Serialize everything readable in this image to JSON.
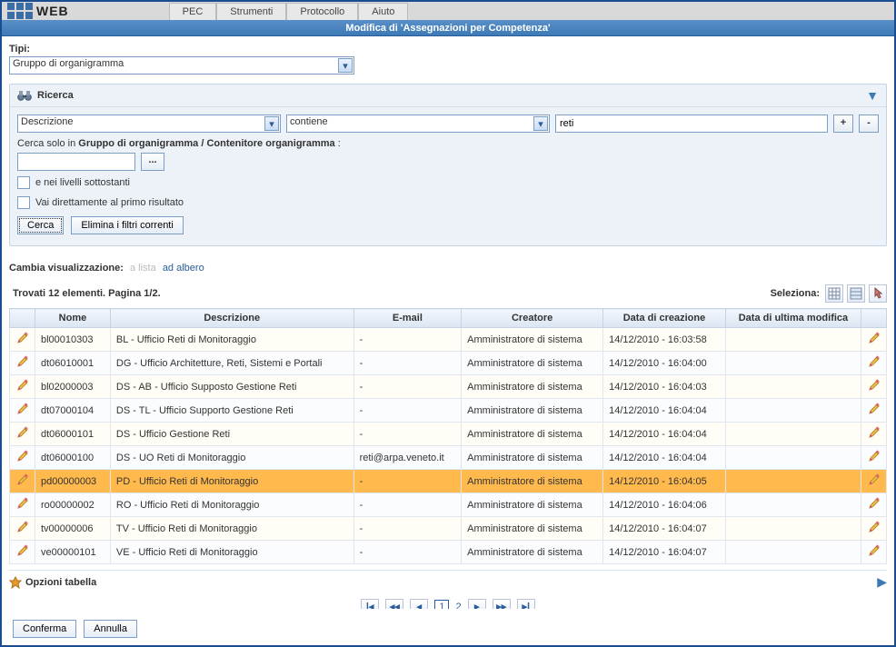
{
  "logo_text": "WEB",
  "menu": [
    "PEC",
    "Strumenti",
    "Protocollo",
    "Aiuto"
  ],
  "window_title": "Modifica di 'Assegnazioni per Competenza'",
  "tipi_label": "Tipi:",
  "tipi_value": "Gruppo di organigramma",
  "ricerca": {
    "title": "Ricerca",
    "field": "Descrizione",
    "operator": "contiene",
    "value": "reti",
    "plus": "+",
    "minus": "-",
    "scope_prefix": "Cerca solo in ",
    "scope_bold": "Gruppo di organigramma / Contenitore organigramma",
    "scope_suffix": " :",
    "dots": "...",
    "sublevels_label": "e nei livelli sottostanti",
    "goto_first_label": "Vai direttamente al primo risultato",
    "btn_search": "Cerca",
    "btn_clear": "Elimina i filtri correnti"
  },
  "cambia": {
    "label": "Cambia visualizzazione:",
    "lista": "a lista",
    "albero": "ad albero"
  },
  "results_header": "Trovati 12 elementi. Pagina 1/2.",
  "seleziona_label": "Seleziona:",
  "columns": {
    "nome": "Nome",
    "descrizione": "Descrizione",
    "email": "E-mail",
    "creatore": "Creatore",
    "data_creazione": "Data di creazione",
    "data_modifica": "Data di ultima modifica"
  },
  "rows": [
    {
      "nome": "bl00010303",
      "descrizione": "BL - Ufficio Reti di Monitoraggio",
      "email": "-",
      "creatore": "Amministratore di sistema",
      "data_creazione": "14/12/2010 - 16:03:58",
      "data_modifica": ""
    },
    {
      "nome": "dt06010001",
      "descrizione": "DG - Ufficio Architetture, Reti, Sistemi e Portali",
      "email": "-",
      "creatore": "Amministratore di sistema",
      "data_creazione": "14/12/2010 - 16:04:00",
      "data_modifica": ""
    },
    {
      "nome": "bl02000003",
      "descrizione": "DS - AB - Ufficio Supposto Gestione Reti",
      "email": "-",
      "creatore": "Amministratore di sistema",
      "data_creazione": "14/12/2010 - 16:04:03",
      "data_modifica": ""
    },
    {
      "nome": "dt07000104",
      "descrizione": "DS - TL - Ufficio Supporto Gestione Reti",
      "email": "-",
      "creatore": "Amministratore di sistema",
      "data_creazione": "14/12/2010 - 16:04:04",
      "data_modifica": ""
    },
    {
      "nome": "dt06000101",
      "descrizione": "DS - Ufficio Gestione Reti",
      "email": "-",
      "creatore": "Amministratore di sistema",
      "data_creazione": "14/12/2010 - 16:04:04",
      "data_modifica": ""
    },
    {
      "nome": "dt06000100",
      "descrizione": "DS - UO Reti di Monitoraggio",
      "email": "reti@arpa.veneto.it",
      "creatore": "Amministratore di sistema",
      "data_creazione": "14/12/2010 - 16:04:04",
      "data_modifica": ""
    },
    {
      "nome": "pd00000003",
      "descrizione": "PD - Ufficio Reti di Monitoraggio",
      "email": "-",
      "creatore": "Amministratore di sistema",
      "data_creazione": "14/12/2010 - 16:04:05",
      "data_modifica": "",
      "selected": true
    },
    {
      "nome": "ro00000002",
      "descrizione": "RO - Ufficio Reti di Monitoraggio",
      "email": "-",
      "creatore": "Amministratore di sistema",
      "data_creazione": "14/12/2010 - 16:04:06",
      "data_modifica": ""
    },
    {
      "nome": "tv00000006",
      "descrizione": "TV - Ufficio Reti di Monitoraggio",
      "email": "-",
      "creatore": "Amministratore di sistema",
      "data_creazione": "14/12/2010 - 16:04:07",
      "data_modifica": ""
    },
    {
      "nome": "ve00000101",
      "descrizione": "VE - Ufficio Reti di Monitoraggio",
      "email": "-",
      "creatore": "Amministratore di sistema",
      "data_creazione": "14/12/2010 - 16:04:07",
      "data_modifica": ""
    }
  ],
  "opzioni_label": "Opzioni tabella",
  "pager": {
    "pages": [
      "1",
      "2"
    ],
    "current": "1"
  },
  "footer": {
    "confirm": "Conferma",
    "cancel": "Annulla"
  },
  "icons": {
    "binoculars": "binoculars-icon",
    "pencil": "pencil-icon",
    "star": "star-icon",
    "grid1": "select-all-icon",
    "grid2": "select-page-icon",
    "hand": "select-pointer-icon"
  }
}
